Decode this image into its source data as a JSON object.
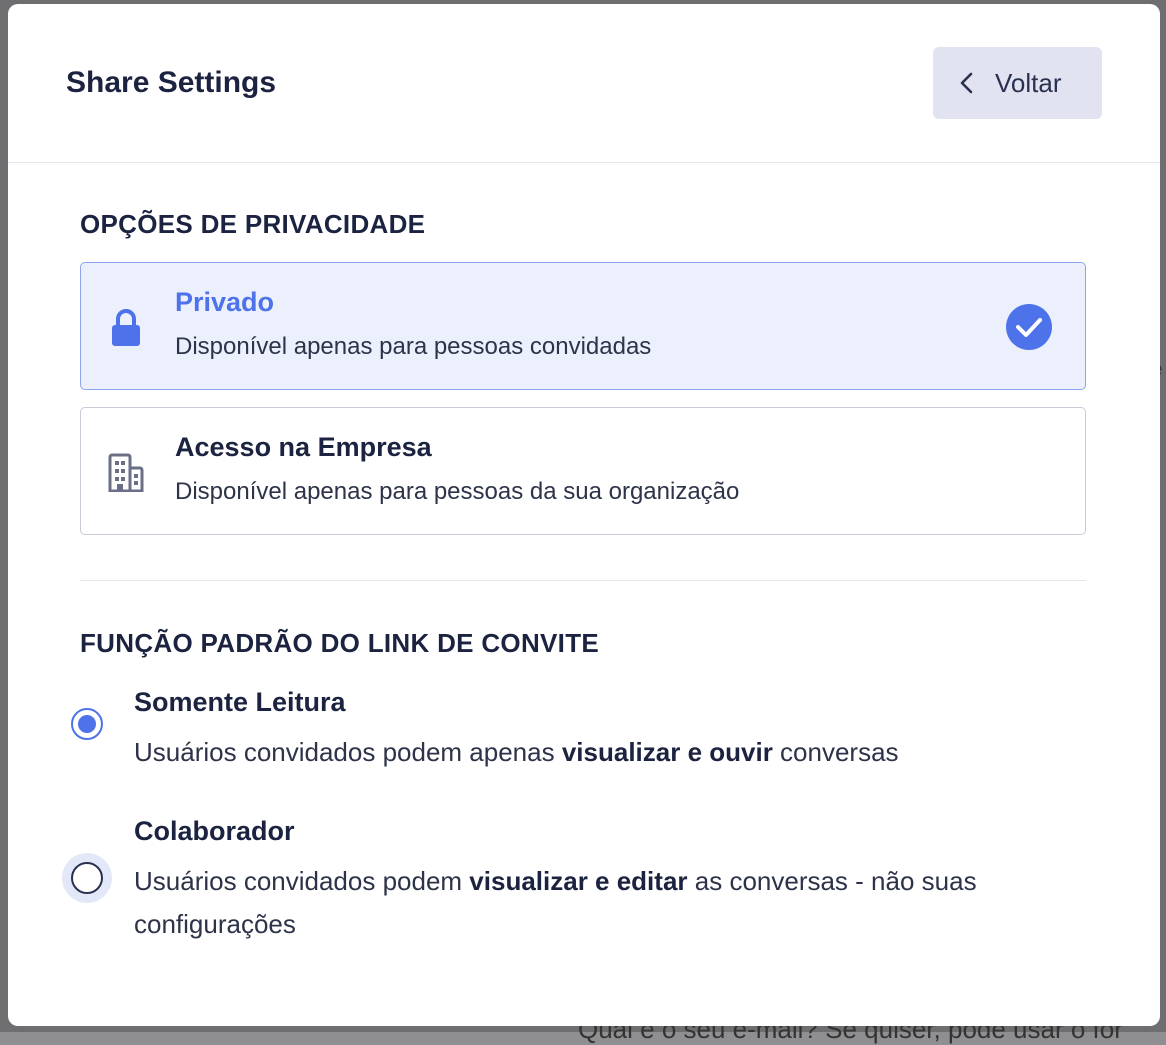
{
  "background": {
    "right_fragment": "e",
    "bottom_fragment": "Qual é o seu e-mail? Se quiser, pode usar o for"
  },
  "modal": {
    "title": "Share Settings",
    "back_button": {
      "label": "Voltar",
      "icon": "chevron-left-icon"
    }
  },
  "privacy": {
    "section_title": "OPÇÕES DE PRIVACIDADE",
    "options": [
      {
        "name": "Privado",
        "description": "Disponível apenas para pessoas convidadas",
        "icon": "lock-icon",
        "selected": true
      },
      {
        "name": "Acesso na Empresa",
        "description": "Disponível apenas para pessoas da sua organização",
        "icon": "building-icon",
        "selected": false
      }
    ]
  },
  "invite_role": {
    "section_title": "FUNÇÃO PADRÃO DO LINK DE CONVITE",
    "options": [
      {
        "name": "Somente Leitura",
        "desc_before": "Usuários convidados podem apenas ",
        "desc_bold": "visualizar e ouvir",
        "desc_after": " conversas",
        "selected": true
      },
      {
        "name": "Colaborador",
        "desc_before": "Usuários convidados podem ",
        "desc_bold": "visualizar e editar",
        "desc_after": " as conversas - não suas configurações",
        "selected": false
      }
    ]
  },
  "colors": {
    "accent": "#4d72e9",
    "selected_card_bg": "#ecf0fd",
    "back_button_bg": "#e1e3f1",
    "text_dark": "#1c2340"
  }
}
